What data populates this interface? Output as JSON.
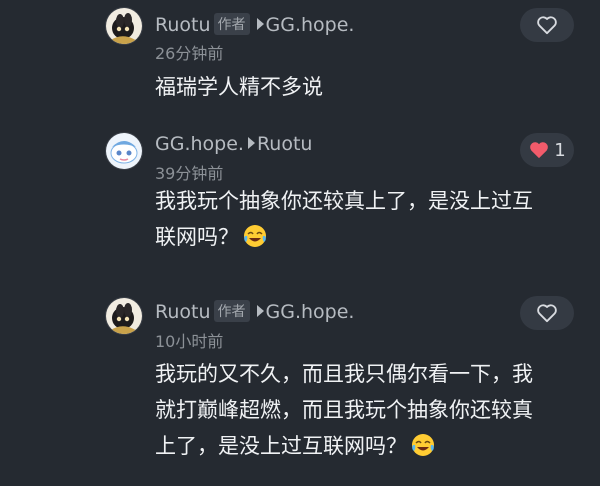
{
  "comments": [
    {
      "author": "Ruotu",
      "author_badge": "作者",
      "reply_to": "GG.hope.",
      "time": "26分钟前",
      "content": "福瑞学人精不多说",
      "liked": false,
      "like_count": ""
    },
    {
      "author": "GG.hope.",
      "author_badge": "",
      "reply_to": "Ruotu",
      "time": "39分钟前",
      "content_line1": "我我玩个抽象你还较真上了，是没上过互",
      "content_line2": "联网吗？",
      "emoji": "laugh-cry-emoji",
      "liked": true,
      "like_count": "1"
    },
    {
      "author": "Ruotu",
      "author_badge": "作者",
      "reply_to": "GG.hope.",
      "time": "10小时前",
      "content_line1": "我玩的又不久，而且我只偶尔看一下，我",
      "content_line2": "就打巅峰超燃，而且我玩个抽象你还较真",
      "content_line3": "上了，是没上过互联网吗？",
      "emoji": "laugh-cry-emoji",
      "liked": false,
      "like_count": ""
    }
  ],
  "colors": {
    "background": "#252a31",
    "like_active": "#f25b6b"
  }
}
